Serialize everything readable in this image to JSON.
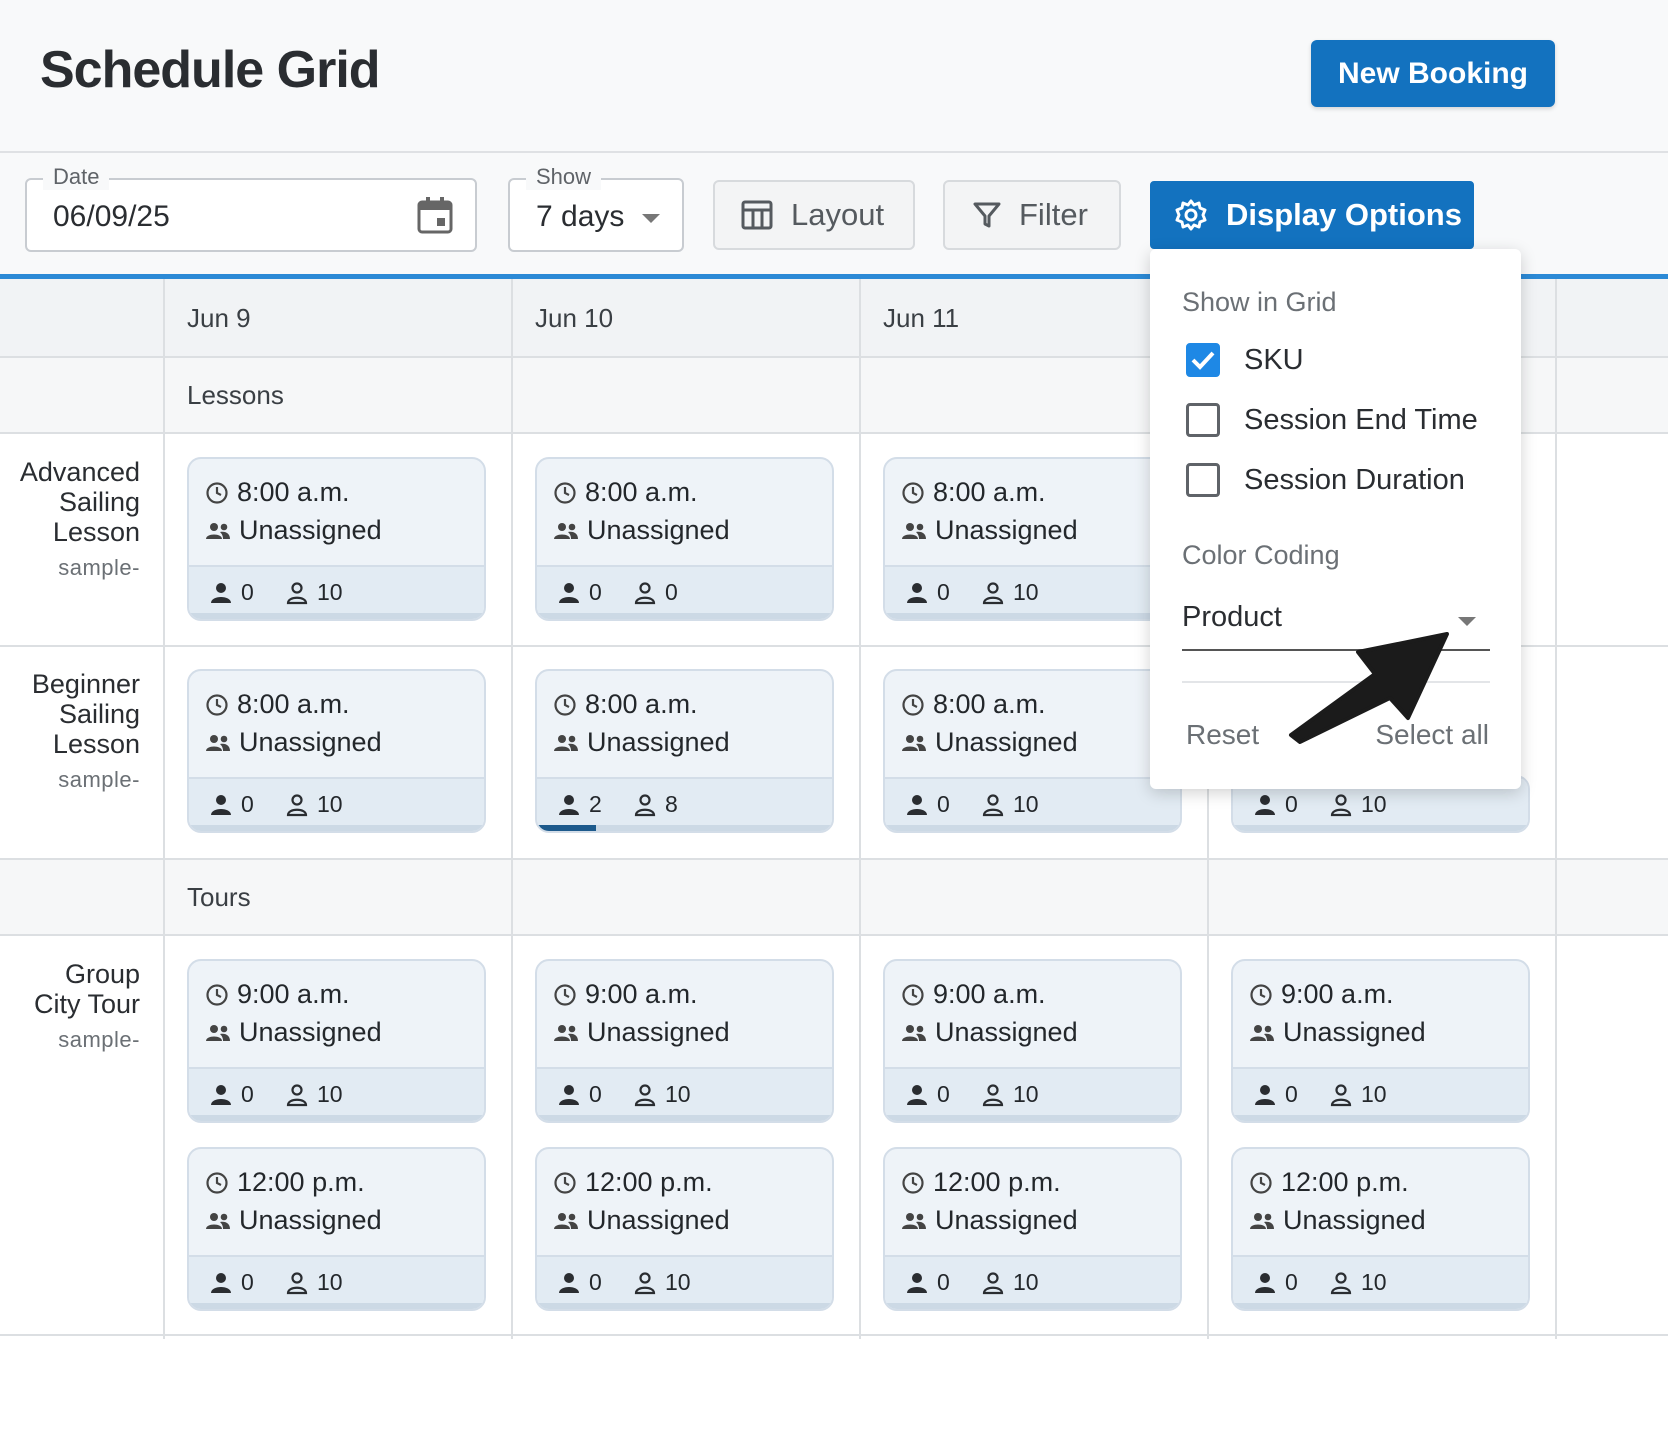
{
  "header": {
    "title": "Schedule Grid",
    "new_booking_label": "New Booking"
  },
  "toolbar": {
    "date_legend": "Date",
    "date_value": "06/09/25",
    "show_legend": "Show",
    "show_value": "7 days",
    "layout_label": "Layout",
    "filter_label": "Filter",
    "display_options_label": "Display Options"
  },
  "grid": {
    "dates": [
      "Jun 9",
      "Jun 10",
      "Jun 11"
    ],
    "groups": [
      "Lessons",
      "Tours"
    ],
    "rows": [
      {
        "name_lines": [
          "Advanced",
          "Sailing",
          "Lesson"
        ],
        "sku": "sample-"
      },
      {
        "name_lines": [
          "Beginner",
          "Sailing",
          "Lesson"
        ],
        "sku": "sample-"
      },
      {
        "name_lines": [
          "Group",
          "City Tour"
        ],
        "sku": "sample-"
      }
    ],
    "status_label": "Unassigned",
    "cards": [
      {
        "time": "8:00 a.m.",
        "booked": "0",
        "available": "10",
        "fill": 0
      },
      {
        "time": "8:00 a.m.",
        "booked": "0",
        "available": "0",
        "fill": 0
      },
      {
        "time": "8:00 a.m.",
        "booked": "0",
        "available": "10",
        "fill": 0
      },
      {
        "time": "8:00 a.m.",
        "booked": "0",
        "available": "10",
        "fill": 0
      },
      {
        "time": "8:00 a.m.",
        "booked": "2",
        "available": "8",
        "fill": 0.2
      },
      {
        "time": "8:00 a.m.",
        "booked": "0",
        "available": "10",
        "fill": 0
      },
      {
        "time": "",
        "booked": "0",
        "available": "10",
        "fill": 0
      },
      {
        "time": "9:00 a.m.",
        "booked": "0",
        "available": "10",
        "fill": 0
      },
      {
        "time": "9:00 a.m.",
        "booked": "0",
        "available": "10",
        "fill": 0
      },
      {
        "time": "9:00 a.m.",
        "booked": "0",
        "available": "10",
        "fill": 0
      },
      {
        "time": "9:00 a.m.",
        "booked": "0",
        "available": "10",
        "fill": 0
      },
      {
        "time": "12:00 p.m.",
        "booked": "0",
        "available": "10",
        "fill": 0
      },
      {
        "time": "12:00 p.m.",
        "booked": "0",
        "available": "10",
        "fill": 0
      },
      {
        "time": "12:00 p.m.",
        "booked": "0",
        "available": "10",
        "fill": 0
      },
      {
        "time": "12:00 p.m.",
        "booked": "0",
        "available": "10",
        "fill": 0
      }
    ]
  },
  "display_options": {
    "show_in_grid_label": "Show in Grid",
    "options": [
      {
        "label": "SKU",
        "checked": true
      },
      {
        "label": "Session End Time",
        "checked": false
      },
      {
        "label": "Session Duration",
        "checked": false
      }
    ],
    "color_coding_label": "Color Coding",
    "color_coding_value": "Product",
    "reset_label": "Reset",
    "select_all_label": "Select all"
  },
  "colors": {
    "primary": "#1372bf",
    "accent_line": "#2c8ad6",
    "checkbox_checked": "#1e88e5"
  }
}
